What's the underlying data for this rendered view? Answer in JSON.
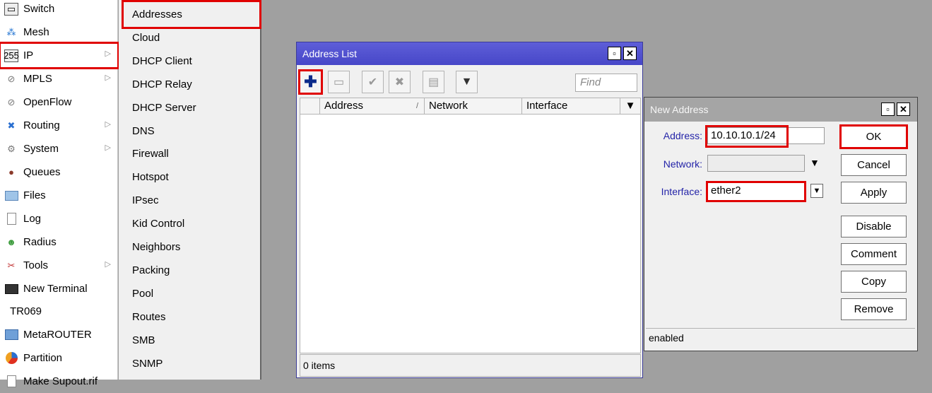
{
  "main_menu": {
    "items": [
      {
        "label": "Switch",
        "icon": "switch-icon"
      },
      {
        "label": "Mesh",
        "icon": "mesh-icon"
      },
      {
        "label": "IP",
        "icon": "ip-icon",
        "submenu": true
      },
      {
        "label": "MPLS",
        "icon": "mpls-icon",
        "submenu": true
      },
      {
        "label": "OpenFlow",
        "icon": "openflow-icon"
      },
      {
        "label": "Routing",
        "icon": "routing-icon",
        "submenu": true
      },
      {
        "label": "System",
        "icon": "system-icon",
        "submenu": true
      },
      {
        "label": "Queues",
        "icon": "queues-icon"
      },
      {
        "label": "Files",
        "icon": "files-icon"
      },
      {
        "label": "Log",
        "icon": "log-icon"
      },
      {
        "label": "Radius",
        "icon": "radius-icon"
      },
      {
        "label": "Tools",
        "icon": "tools-icon",
        "submenu": true
      },
      {
        "label": "New Terminal",
        "icon": "terminal-icon"
      },
      {
        "label": "TR069",
        "icon": ""
      },
      {
        "label": "MetaROUTER",
        "icon": "metarouter-icon"
      },
      {
        "label": "Partition",
        "icon": "partition-icon"
      },
      {
        "label": "Make Supout.rif",
        "icon": "supout-icon"
      }
    ],
    "submenu_arrow": "▷"
  },
  "ip_submenu": {
    "items": [
      "Addresses",
      "Cloud",
      "DHCP Client",
      "DHCP Relay",
      "DHCP Server",
      "DNS",
      "Firewall",
      "Hotspot",
      "IPsec",
      "Kid Control",
      "Neighbors",
      "Packing",
      "Pool",
      "Routes",
      "SMB",
      "SNMP"
    ]
  },
  "address_list": {
    "title": "Address List",
    "find_placeholder": "Find",
    "columns": [
      "Address",
      "/",
      "Network",
      "Interface"
    ],
    "status": "0 items"
  },
  "new_address": {
    "title": "New Address",
    "address_label": "Address:",
    "address_value": "10.10.10.1/24",
    "network_label": "Network:",
    "network_value": "",
    "interface_label": "Interface:",
    "interface_value": "ether2",
    "buttons": [
      "OK",
      "Cancel",
      "Apply",
      "Disable",
      "Comment",
      "Copy",
      "Remove"
    ],
    "status": "enabled"
  },
  "colors": {
    "highlight": "#e00000",
    "title_active": "#4d4dcc",
    "title_inactive": "#a5a5a5",
    "add_icon": "#0a2a8a"
  }
}
